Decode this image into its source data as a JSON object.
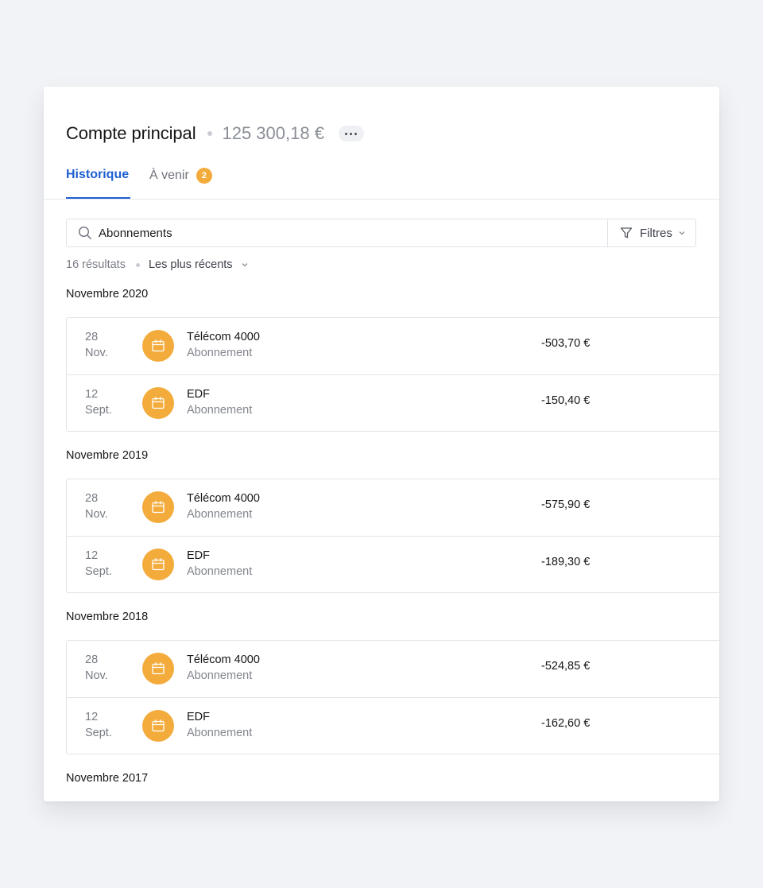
{
  "account": {
    "title": "Compte principal",
    "balance": "125 300,18 €"
  },
  "tabs": [
    {
      "label": "Historique",
      "active": true
    },
    {
      "label": "À venir",
      "badge": "2"
    }
  ],
  "search": {
    "value": "Abonnements"
  },
  "filter": {
    "label": "Filtres"
  },
  "results": {
    "count": "16 résultats",
    "sort": "Les plus récents"
  },
  "groups": [
    {
      "title": "Novembre 2020",
      "items": [
        {
          "day": "28",
          "month": "Nov.",
          "merchant": "Télécom 4000",
          "category": "Abonnement",
          "amount": "-503,70 €",
          "icon": "calendar-icon"
        },
        {
          "day": "12",
          "month": "Sept.",
          "merchant": "EDF",
          "category": "Abonnement",
          "amount": "-150,40 €",
          "icon": "calendar-icon"
        }
      ]
    },
    {
      "title": "Novembre 2019",
      "items": [
        {
          "day": "28",
          "month": "Nov.",
          "merchant": "Télécom 4000",
          "category": "Abonnement",
          "amount": "-575,90 €",
          "icon": "calendar-icon"
        },
        {
          "day": "12",
          "month": "Sept.",
          "merchant": "EDF",
          "category": "Abonnement",
          "amount": "-189,30 €",
          "icon": "calendar-icon"
        }
      ]
    },
    {
      "title": "Novembre 2018",
      "items": [
        {
          "day": "28",
          "month": "Nov.",
          "merchant": "Télécom 4000",
          "category": "Abonnement",
          "amount": "-524,85 €",
          "icon": "calendar-icon"
        },
        {
          "day": "12",
          "month": "Sept.",
          "merchant": "EDF",
          "category": "Abonnement",
          "amount": "-162,60 €",
          "icon": "calendar-icon"
        }
      ]
    },
    {
      "title": "Novembre 2017",
      "items": []
    }
  ],
  "colors": {
    "accent": "#1f5fd1",
    "badge": "#f3ac3c",
    "avatar": "#f3ac3c",
    "background": "#f2f3f6"
  }
}
